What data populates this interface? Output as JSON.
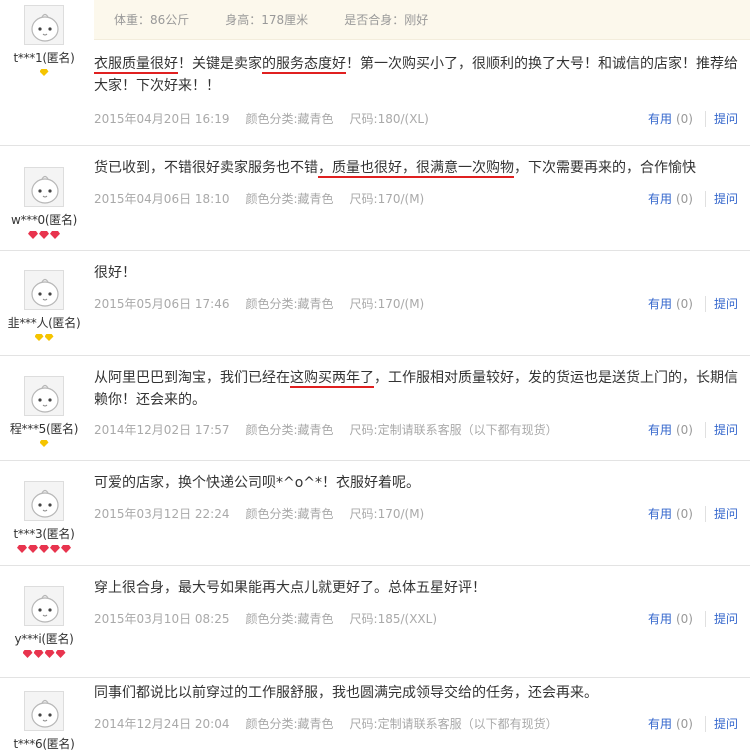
{
  "top_info": {
    "weight": "体重：86公斤",
    "height": "身高：178厘米",
    "fit": "是否合身：刚好"
  },
  "actions": {
    "useful": "有用",
    "count": "(0)",
    "ask": "提问"
  },
  "reviews": [
    {
      "user": "t***1(匿名)",
      "badge": "yellow",
      "badge_count": 1,
      "content_parts": [
        {
          "text": "衣服质量很好",
          "underline": true
        },
        {
          "text": "！关键是卖家",
          "underline": false
        },
        {
          "text": "的服务态度好",
          "underline": true
        },
        {
          "text": "！第一次购买小了，很顺利的换了大号！和诚信的店家！推荐给大家！下次好来！！",
          "underline": false
        }
      ],
      "date": "2015年04月20日 16:19",
      "color": "颜色分类:藏青色",
      "size": "尺码:180/(XL)"
    },
    {
      "user": "w***0(匿名)",
      "badge": "red",
      "badge_count": 3,
      "content_parts": [
        {
          "text": "货已收到，不错很好卖家服务也不错",
          "underline": false
        },
        {
          "text": "，质量也很好，",
          "underline": true
        },
        {
          "text": "很满意一次购物",
          "underline": true
        },
        {
          "text": "，下次需要再来的，合作愉快",
          "underline": false
        }
      ],
      "date": "2015年04月06日 18:10",
      "color": "颜色分类:藏青色",
      "size": "尺码:170/(M)"
    },
    {
      "user": "韭***人(匿名)",
      "badge": "yellow",
      "badge_count": 2,
      "content_parts": [
        {
          "text": "很好！",
          "underline": false
        }
      ],
      "date": "2015年05月06日 17:46",
      "color": "颜色分类:藏青色",
      "size": "尺码:170/(M)"
    },
    {
      "user": "程***5(匿名)",
      "badge": "yellow",
      "badge_count": 1,
      "content_parts": [
        {
          "text": "从阿里巴巴到淘宝，我们已经在",
          "underline": false
        },
        {
          "text": "这购买两年了",
          "underline": true
        },
        {
          "text": "，工作服相对质量较好，发的货运也是送货上门的，长期信赖你！还会来的。",
          "underline": false
        }
      ],
      "date": "2014年12月02日 17:57",
      "color": "颜色分类:藏青色",
      "size": "尺码:定制请联系客服（以下都有现货）"
    },
    {
      "user": "t***3(匿名)",
      "badge": "red",
      "badge_count": 5,
      "content_parts": [
        {
          "text": "可爱的店家，换个快递公司呗*^o^*！衣服好着呢。",
          "underline": false
        }
      ],
      "date": "2015年03月12日 22:24",
      "color": "颜色分类:藏青色",
      "size": "尺码:170/(M)"
    },
    {
      "user": "y***i(匿名)",
      "badge": "red",
      "badge_count": 4,
      "content_parts": [
        {
          "text": "穿上很合身，最大号如果能再大点儿就更好了。总体五星好评！",
          "underline": false
        }
      ],
      "date": "2015年03月10日 08:25",
      "color": "颜色分类:藏青色",
      "size": "尺码:185/(XXL)"
    },
    {
      "user": "t***6(匿名)",
      "badge": "none",
      "badge_count": 0,
      "content_parts": [
        {
          "text": "同事们都说比以前穿过的工作服舒服，我也圆满完成领导交给的任务，还会再来。",
          "underline": false
        }
      ],
      "date": "2014年12月24日 20:04",
      "color": "颜色分类:藏青色",
      "size": "尺码:定制请联系客服（以下都有现货）"
    }
  ]
}
